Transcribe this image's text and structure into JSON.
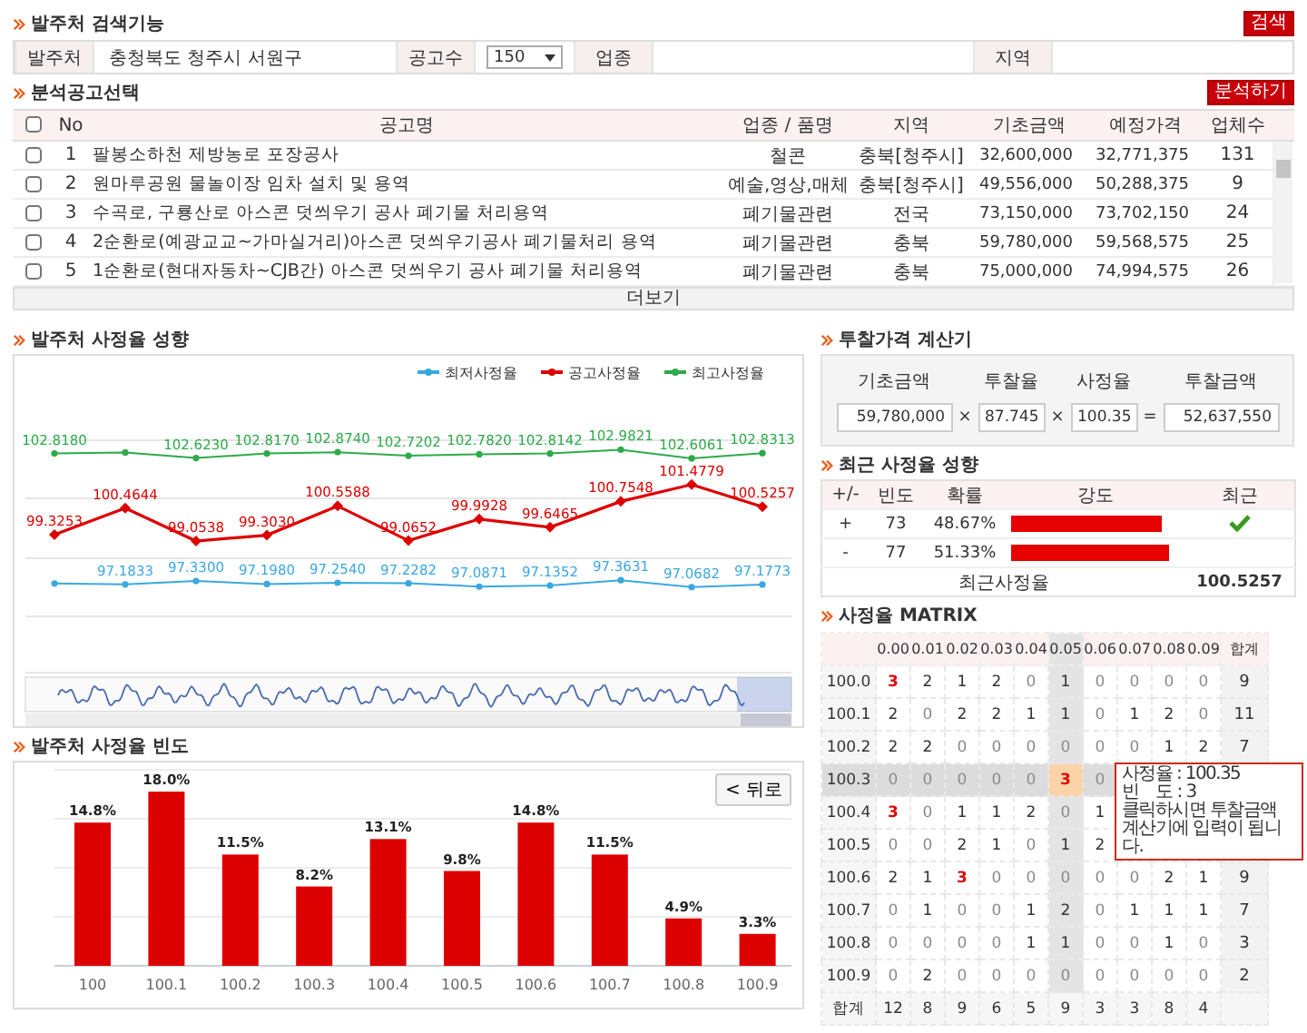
{
  "search_section": {
    "title": "발주처 검색기능",
    "button": "검색",
    "fields": [
      {
        "label": "발주처",
        "kind": "text",
        "value": "충청북도 청주시 서원구"
      },
      {
        "label": "공고수",
        "kind": "select",
        "value": "150"
      },
      {
        "label": "업종",
        "kind": "text"
      },
      {
        "label": "지역",
        "kind": "text"
      }
    ]
  },
  "notice_section": {
    "title": "분석공고선택",
    "button": "분석하기",
    "all_checked": false,
    "columns": [
      "No",
      "공고명",
      "업종 / 품명",
      "지역",
      "기초금액",
      "예정가격",
      "업체수"
    ],
    "rows": [
      {
        "checked": false,
        "cells": [
          "1",
          "팔봉소하천 제방농로 포장공사",
          "철콘",
          "충북[청주시]",
          "32,600,000",
          "32,771,375",
          "131"
        ]
      },
      {
        "checked": false,
        "cells": [
          "2",
          "원마루공원 물놀이장 임차 설치 및 용역",
          "예술,영상,매체",
          "충북[청주시]",
          "49,556,000",
          "50,288,375",
          "9"
        ]
      },
      {
        "checked": false,
        "cells": [
          "3",
          "수곡로, 구룡산로 아스콘 덧씌우기 공사 폐기물 처리용역",
          "폐기물관련",
          "전국",
          "73,150,000",
          "73,702,150",
          "24"
        ]
      },
      {
        "checked": false,
        "cells": [
          "4",
          "2순환로(예광교교~가마실거리)아스콘 덧씌우기공사 폐기물처리 용역",
          "폐기물관련",
          "충북",
          "59,780,000",
          "59,568,575",
          "25"
        ]
      },
      {
        "checked": false,
        "cells": [
          "5",
          "1순환로(현대자동차~CJB간) 아스콘 덧씌우기 공사 폐기물 처리용역",
          "폐기물관련",
          "충북",
          "75,000,000",
          "74,994,575",
          "26"
        ]
      }
    ],
    "more": "더보기"
  },
  "trend_section": {
    "title": "발주처 사정율 성향",
    "chart_data": {
      "type": "line",
      "data_labels": true,
      "legend": true,
      "series": [
        {
          "name": "최저사정율",
          "color": "#3aa8e0",
          "marker": "circle",
          "values": [
            97.22,
            97.1833,
            97.33,
            97.198,
            97.254,
            97.2282,
            97.0871,
            97.1352,
            97.3631,
            97.0682,
            97.1773
          ],
          "value_labels": [
            null,
            "97.1833",
            "97.3300",
            "97.1980",
            "97.2540",
            "97.2282",
            "97.0871",
            "97.1352",
            "97.3631",
            "97.0682",
            "97.1773"
          ]
        },
        {
          "name": "공고사정율",
          "color": "#dd0000",
          "marker": "diamond",
          "values": [
            99.3253,
            100.4644,
            99.0538,
            99.303,
            100.5588,
            99.0652,
            99.9928,
            99.6465,
            100.7548,
            101.4779,
            100.5257
          ],
          "value_labels": [
            "99.3253",
            "100.4644",
            "99.0538",
            "99.3030",
            "100.5588",
            "99.0652",
            "99.9928",
            "99.6465",
            "100.7548",
            "101.4779",
            "100.5257"
          ]
        },
        {
          "name": "최고사정율",
          "color": "#2eaa4a",
          "marker": "circle",
          "values": [
            102.818,
            102.86,
            102.623,
            102.817,
            102.874,
            102.7202,
            102.782,
            102.8142,
            102.9821,
            102.6061,
            102.8313
          ],
          "value_labels": [
            "102.8180",
            null,
            "102.6230",
            "102.8170",
            "102.8740",
            "102.7202",
            "102.7820",
            "102.8142",
            "102.9821",
            "102.6061",
            "102.8313"
          ]
        }
      ]
    }
  },
  "freq_section": {
    "title": "발주처 사정율 빈도",
    "reset_button": "< 뒤로",
    "chart_data": {
      "type": "bar",
      "data_labels": true,
      "categories": [
        "100",
        "100.1",
        "100.2",
        "100.3",
        "100.4",
        "100.5",
        "100.6",
        "100.7",
        "100.8",
        "100.9"
      ],
      "series": [
        {
          "color": "#dd0000",
          "values": [
            14.8,
            18.0,
            11.5,
            8.2,
            13.1,
            9.8,
            14.8,
            11.5,
            4.9,
            3.3
          ],
          "value_labels": [
            "14.8%",
            "18.0%",
            "11.5%",
            "8.2%",
            "13.1%",
            "9.8%",
            "14.8%",
            "11.5%",
            "4.9%",
            "3.3%"
          ]
        }
      ]
    }
  },
  "calculator": {
    "title": "투찰가격 계산기",
    "fields": [
      {
        "label": "기초금액",
        "value": "59,780,000"
      },
      {
        "label": "투찰율",
        "value": "87.745"
      },
      {
        "label": "사정율",
        "value": "100.35"
      },
      {
        "label": "투찰금액",
        "value": "52,637,550"
      }
    ],
    "operators": [
      "×",
      "×",
      "="
    ]
  },
  "recent": {
    "title": "최근 사정율 성향",
    "columns": [
      "+/-",
      "빈도",
      "확률",
      "강도",
      "최근"
    ],
    "rows": [
      {
        "sign": "+",
        "count": "73",
        "ratio": "48.67%",
        "level": 0.93,
        "recent": true
      },
      {
        "sign": "-",
        "count": "77",
        "ratio": "51.33%",
        "level": 0.97,
        "recent": false
      }
    ],
    "footer_label": "최근사정율",
    "footer_value": "100.5257"
  },
  "matrix": {
    "title": "사정율 MATRIX",
    "total_label": "합계",
    "footer_label": "합계",
    "columns": [
      {
        "label": "0.00",
        "selected": false
      },
      {
        "label": "0.01",
        "selected": false
      },
      {
        "label": "0.02",
        "selected": false
      },
      {
        "label": "0.03",
        "selected": false
      },
      {
        "label": "0.04",
        "selected": false
      },
      {
        "label": "0.05",
        "selected": true
      },
      {
        "label": "0.06",
        "selected": false
      },
      {
        "label": "0.07",
        "selected": false
      },
      {
        "label": "0.08",
        "selected": false
      },
      {
        "label": "0.09",
        "selected": false
      }
    ],
    "rows": [
      {
        "label": "100.0",
        "selected": false,
        "total": "9",
        "cells": [
          {
            "v": "3",
            "muted": false,
            "hot": true,
            "selected": false
          },
          {
            "v": "2",
            "muted": false,
            "hot": false,
            "selected": false
          },
          {
            "v": "1",
            "muted": false,
            "hot": false,
            "selected": false
          },
          {
            "v": "2",
            "muted": false,
            "hot": false,
            "selected": false
          },
          {
            "v": "0",
            "muted": true,
            "hot": false,
            "selected": false
          },
          {
            "v": "1",
            "muted": false,
            "hot": false,
            "selected": false
          },
          {
            "v": "0",
            "muted": true,
            "hot": false,
            "selected": false
          },
          {
            "v": "0",
            "muted": true,
            "hot": false,
            "selected": false
          },
          {
            "v": "0",
            "muted": true,
            "hot": false,
            "selected": false
          },
          {
            "v": "0",
            "muted": true,
            "hot": false,
            "selected": false
          }
        ]
      },
      {
        "label": "100.1",
        "selected": false,
        "total": "11",
        "cells": [
          {
            "v": "2",
            "muted": false,
            "hot": false,
            "selected": false
          },
          {
            "v": "0",
            "muted": true,
            "hot": false,
            "selected": false
          },
          {
            "v": "2",
            "muted": false,
            "hot": false,
            "selected": false
          },
          {
            "v": "2",
            "muted": false,
            "hot": false,
            "selected": false
          },
          {
            "v": "1",
            "muted": false,
            "hot": false,
            "selected": false
          },
          {
            "v": "1",
            "muted": false,
            "hot": false,
            "selected": false
          },
          {
            "v": "0",
            "muted": true,
            "hot": false,
            "selected": false
          },
          {
            "v": "1",
            "muted": false,
            "hot": false,
            "selected": false
          },
          {
            "v": "2",
            "muted": false,
            "hot": false,
            "selected": false
          },
          {
            "v": "0",
            "muted": true,
            "hot": false,
            "selected": false
          }
        ]
      },
      {
        "label": "100.2",
        "selected": false,
        "total": "7",
        "cells": [
          {
            "v": "2",
            "muted": false,
            "hot": false,
            "selected": false
          },
          {
            "v": "2",
            "muted": false,
            "hot": false,
            "selected": false
          },
          {
            "v": "0",
            "muted": true,
            "hot": false,
            "selected": false
          },
          {
            "v": "0",
            "muted": true,
            "hot": false,
            "selected": false
          },
          {
            "v": "0",
            "muted": true,
            "hot": false,
            "selected": false
          },
          {
            "v": "0",
            "muted": true,
            "hot": false,
            "selected": false
          },
          {
            "v": "0",
            "muted": true,
            "hot": false,
            "selected": false
          },
          {
            "v": "0",
            "muted": true,
            "hot": false,
            "selected": false
          },
          {
            "v": "1",
            "muted": false,
            "hot": false,
            "selected": false
          },
          {
            "v": "2",
            "muted": false,
            "hot": false,
            "selected": false
          }
        ]
      },
      {
        "label": "100.3",
        "selected": true,
        "cells": [
          {
            "v": "0",
            "muted": true,
            "hot": false,
            "selected": false
          },
          {
            "v": "0",
            "muted": true,
            "hot": false,
            "selected": false
          },
          {
            "v": "0",
            "muted": true,
            "hot": false,
            "selected": false
          },
          {
            "v": "0",
            "muted": true,
            "hot": false,
            "selected": false
          },
          {
            "v": "0",
            "muted": true,
            "hot": false,
            "selected": false
          },
          {
            "v": "3",
            "muted": false,
            "hot": true,
            "selected": true
          },
          {
            "v": "0",
            "muted": true,
            "hot": false,
            "selected": false
          }
        ]
      },
      {
        "label": "100.4",
        "selected": false,
        "cells": [
          {
            "v": "3",
            "muted": false,
            "hot": true,
            "selected": false
          },
          {
            "v": "0",
            "muted": true,
            "hot": false,
            "selected": false
          },
          {
            "v": "1",
            "muted": false,
            "hot": false,
            "selected": false
          },
          {
            "v": "1",
            "muted": false,
            "hot": false,
            "selected": false
          },
          {
            "v": "2",
            "muted": false,
            "hot": false,
            "selected": false
          },
          {
            "v": "0",
            "muted": true,
            "hot": false,
            "selected": false
          },
          {
            "v": "1",
            "muted": false,
            "hot": false,
            "selected": false
          }
        ]
      },
      {
        "label": "100.5",
        "selected": false,
        "cells": [
          {
            "v": "0",
            "muted": true,
            "hot": false,
            "selected": false
          },
          {
            "v": "0",
            "muted": true,
            "hot": false,
            "selected": false
          },
          {
            "v": "2",
            "muted": false,
            "hot": false,
            "selected": false
          },
          {
            "v": "1",
            "muted": false,
            "hot": false,
            "selected": false
          },
          {
            "v": "0",
            "muted": true,
            "hot": false,
            "selected": false
          },
          {
            "v": "1",
            "muted": false,
            "hot": false,
            "selected": false
          },
          {
            "v": "2",
            "muted": false,
            "hot": false,
            "selected": false
          }
        ]
      },
      {
        "label": "100.6",
        "selected": false,
        "total": "9",
        "cells": [
          {
            "v": "2",
            "muted": false,
            "hot": false,
            "selected": false
          },
          {
            "v": "1",
            "muted": false,
            "hot": false,
            "selected": false
          },
          {
            "v": "3",
            "muted": false,
            "hot": true,
            "selected": false
          },
          {
            "v": "0",
            "muted": true,
            "hot": false,
            "selected": false
          },
          {
            "v": "0",
            "muted": true,
            "hot": false,
            "selected": false
          },
          {
            "v": "0",
            "muted": true,
            "hot": false,
            "selected": false
          },
          {
            "v": "0",
            "muted": true,
            "hot": false,
            "selected": false
          },
          {
            "v": "0",
            "muted": true,
            "hot": false,
            "selected": false
          },
          {
            "v": "2",
            "muted": false,
            "hot": false,
            "selected": false
          },
          {
            "v": "1",
            "muted": false,
            "hot": false,
            "selected": false
          }
        ]
      },
      {
        "label": "100.7",
        "selected": false,
        "total": "7",
        "cells": [
          {
            "v": "0",
            "muted": true,
            "hot": false,
            "selected": false
          },
          {
            "v": "1",
            "muted": false,
            "hot": false,
            "selected": false
          },
          {
            "v": "0",
            "muted": true,
            "hot": false,
            "selected": false
          },
          {
            "v": "0",
            "muted": true,
            "hot": false,
            "selected": false
          },
          {
            "v": "1",
            "muted": false,
            "hot": false,
            "selected": false
          },
          {
            "v": "2",
            "muted": false,
            "hot": false,
            "selected": false
          },
          {
            "v": "0",
            "muted": true,
            "hot": false,
            "selected": false
          },
          {
            "v": "1",
            "muted": false,
            "hot": false,
            "selected": false
          },
          {
            "v": "1",
            "muted": false,
            "hot": false,
            "selected": false
          },
          {
            "v": "1",
            "muted": false,
            "hot": false,
            "selected": false
          }
        ]
      },
      {
        "label": "100.8",
        "selected": false,
        "total": "3",
        "cells": [
          {
            "v": "0",
            "muted": true,
            "hot": false,
            "selected": false
          },
          {
            "v": "0",
            "muted": true,
            "hot": false,
            "selected": false
          },
          {
            "v": "0",
            "muted": true,
            "hot": false,
            "selected": false
          },
          {
            "v": "0",
            "muted": true,
            "hot": false,
            "selected": false
          },
          {
            "v": "1",
            "muted": false,
            "hot": false,
            "selected": false
          },
          {
            "v": "1",
            "muted": false,
            "hot": false,
            "selected": false
          },
          {
            "v": "0",
            "muted": true,
            "hot": false,
            "selected": false
          },
          {
            "v": "0",
            "muted": true,
            "hot": false,
            "selected": false
          },
          {
            "v": "1",
            "muted": false,
            "hot": false,
            "selected": false
          },
          {
            "v": "0",
            "muted": true,
            "hot": false,
            "selected": false
          }
        ]
      },
      {
        "label": "100.9",
        "selected": false,
        "total": "2",
        "cells": [
          {
            "v": "0",
            "muted": true,
            "hot": false,
            "selected": false
          },
          {
            "v": "2",
            "muted": false,
            "hot": false,
            "selected": false
          },
          {
            "v": "0",
            "muted": true,
            "hot": false,
            "selected": false
          },
          {
            "v": "0",
            "muted": true,
            "hot": false,
            "selected": false
          },
          {
            "v": "0",
            "muted": true,
            "hot": false,
            "selected": false
          },
          {
            "v": "0",
            "muted": true,
            "hot": false,
            "selected": false
          },
          {
            "v": "0",
            "muted": true,
            "hot": false,
            "selected": false
          },
          {
            "v": "0",
            "muted": true,
            "hot": false,
            "selected": false
          },
          {
            "v": "0",
            "muted": true,
            "hot": false,
            "selected": false
          },
          {
            "v": "0",
            "muted": true,
            "hot": false,
            "selected": false
          }
        ]
      }
    ],
    "totals": [
      "12",
      "8",
      "9",
      "6",
      "5",
      "9",
      "3",
      "3",
      "8",
      "4"
    ],
    "tooltip": {
      "lines": [
        "사정율 : 100.35",
        "빈    도 : 3",
        "클릭하시면 투찰금액 계산기에 입력이 됩니다."
      ]
    }
  }
}
